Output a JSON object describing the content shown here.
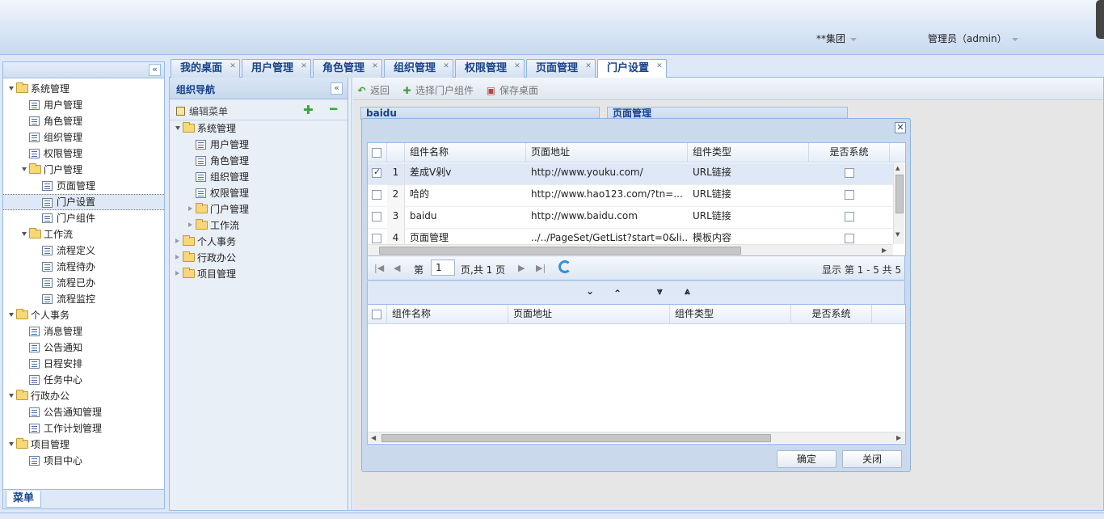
{
  "header": {
    "org_label": "**集团",
    "user_label": "管理员（admin）"
  },
  "sidebar": {
    "footer_tab": "菜单",
    "items": [
      {
        "label": "系统管理",
        "type": "folder",
        "level": 0,
        "open": true
      },
      {
        "label": "用户管理",
        "type": "page",
        "level": 1
      },
      {
        "label": "角色管理",
        "type": "page",
        "level": 1
      },
      {
        "label": "组织管理",
        "type": "page",
        "level": 1
      },
      {
        "label": "权限管理",
        "type": "page",
        "level": 1
      },
      {
        "label": "门户管理",
        "type": "folder",
        "level": 1,
        "open": true
      },
      {
        "label": "页面管理",
        "type": "page",
        "level": 2
      },
      {
        "label": "门户设置",
        "type": "page",
        "level": 2,
        "selected": true
      },
      {
        "label": "门户组件",
        "type": "page",
        "level": 2
      },
      {
        "label": "工作流",
        "type": "folder",
        "level": 1,
        "open": true
      },
      {
        "label": "流程定义",
        "type": "page",
        "level": 2
      },
      {
        "label": "流程待办",
        "type": "page",
        "level": 2
      },
      {
        "label": "流程已办",
        "type": "page",
        "level": 2
      },
      {
        "label": "流程监控",
        "type": "page",
        "level": 2
      },
      {
        "label": "个人事务",
        "type": "folder",
        "level": 0,
        "open": true
      },
      {
        "label": "消息管理",
        "type": "page",
        "level": 1
      },
      {
        "label": "公告通知",
        "type": "page",
        "level": 1
      },
      {
        "label": "日程安排",
        "type": "page",
        "level": 1
      },
      {
        "label": "任务中心",
        "type": "page",
        "level": 1
      },
      {
        "label": "行政办公",
        "type": "folder",
        "level": 0,
        "open": true
      },
      {
        "label": "公告通知管理",
        "type": "page",
        "level": 1
      },
      {
        "label": "工作计划管理",
        "type": "page",
        "level": 1
      },
      {
        "label": "项目管理",
        "type": "folder",
        "level": 0,
        "open": true
      },
      {
        "label": "项目中心",
        "type": "page",
        "level": 1
      }
    ]
  },
  "tabs": [
    {
      "label": "我的桌面"
    },
    {
      "label": "用户管理"
    },
    {
      "label": "角色管理"
    },
    {
      "label": "组织管理"
    },
    {
      "label": "权限管理"
    },
    {
      "label": "页面管理"
    },
    {
      "label": "门户设置",
      "active": true
    }
  ],
  "org_nav": {
    "title": "组织导航",
    "edit_menu": "编辑菜单",
    "items": [
      {
        "label": "系统管理",
        "type": "folder",
        "level": 0,
        "open": true
      },
      {
        "label": "用户管理",
        "type": "page",
        "level": 1
      },
      {
        "label": "角色管理",
        "type": "page",
        "level": 1
      },
      {
        "label": "组织管理",
        "type": "page",
        "level": 1
      },
      {
        "label": "权限管理",
        "type": "page",
        "level": 1
      },
      {
        "label": "门户管理",
        "type": "folder",
        "level": 1,
        "open": false
      },
      {
        "label": "工作流",
        "type": "folder",
        "level": 1,
        "open": false
      },
      {
        "label": "个人事务",
        "type": "folder",
        "level": 0,
        "open": false
      },
      {
        "label": "行政办公",
        "type": "folder",
        "level": 0,
        "open": false
      },
      {
        "label": "项目管理",
        "type": "folder",
        "level": 0,
        "open": false
      }
    ]
  },
  "toolbar": {
    "back": "返回",
    "select_component": "选择门户组件",
    "save_desktop": "保存桌面"
  },
  "portlets": [
    "baidu",
    "页面管理"
  ],
  "dialog": {
    "top_grid": {
      "columns": [
        "组件名称",
        "页面地址",
        "组件类型",
        "是否系统"
      ],
      "rows": [
        {
          "num": "1",
          "name": "差成V剁v",
          "url": "http://www.youku.com/",
          "type": "URL链接",
          "checked": true
        },
        {
          "num": "2",
          "name": "哈的",
          "url": "http://www.hao123.com/?tn=...",
          "type": "URL链接",
          "checked": false
        },
        {
          "num": "3",
          "name": "baidu",
          "url": "http://www.baidu.com",
          "type": "URL链接",
          "checked": false
        },
        {
          "num": "4",
          "name": "页面管理",
          "url": "../../PageSet/GetList?start=0&li...",
          "type": "模板内容",
          "checked": false
        }
      ]
    },
    "pager": {
      "page_prefix": "第",
      "page_value": "1",
      "page_suffix": "页,共 1 页",
      "summary": "显示 第 1 - 5 共 5"
    },
    "bottom_grid": {
      "columns": [
        "组件名称",
        "页面地址",
        "组件类型",
        "是否系统"
      ]
    },
    "confirm": "确定",
    "close": "关闭"
  }
}
